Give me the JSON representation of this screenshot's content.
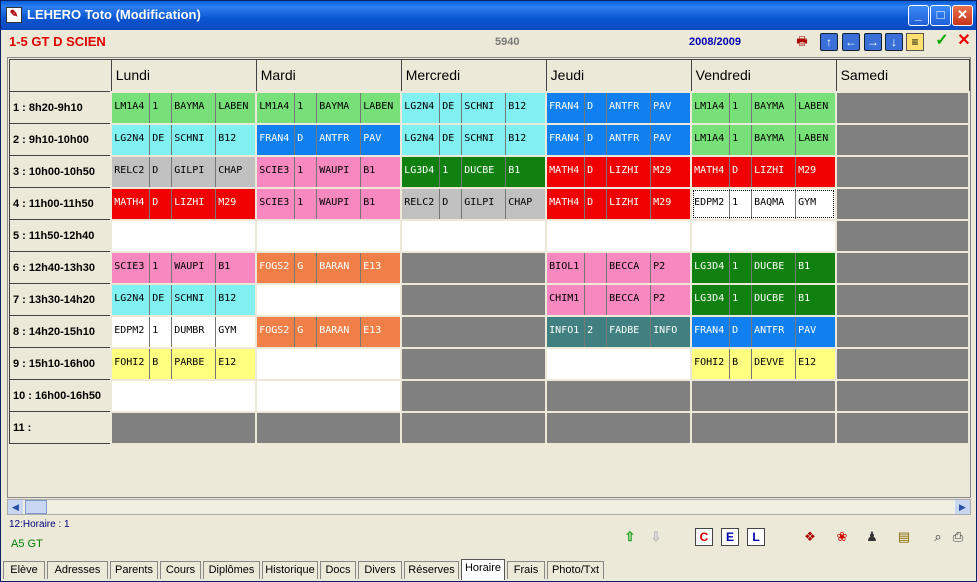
{
  "window": {
    "title": "LEHERO Toto (Modification)"
  },
  "header": {
    "class_name": "1-5 GT D SCIEN",
    "code": "5940",
    "year": "2008/2009"
  },
  "days": [
    "Lundi",
    "Mardi",
    "Mercredi",
    "Jeudi",
    "Vendredi",
    "Samedi"
  ],
  "slots": [
    "1 : 8h20-9h10",
    "2 : 9h10-10h00",
    "3 : 10h00-10h50",
    "4 : 11h00-11h50",
    "5 : 11h50-12h40",
    "6 : 12h40-13h30",
    "7 : 13h30-14h20",
    "8 : 14h20-15h10",
    "9 : 15h10-16h00",
    "10 : 16h00-16h50",
    "11 :"
  ],
  "colors": {
    "green": "#78e078",
    "cyan": "#80f0f0",
    "grey": "#c0c0c0",
    "pink": "#f888c0",
    "red": "#f00000",
    "blue": "#1080f0",
    "darkgreen": "#108010",
    "orange": "#f08048",
    "yellow": "#ffff80",
    "teal": "#408080",
    "white": "#ffffff",
    "empty_grey": "#808080"
  },
  "grid": [
    [
      {
        "color": "green",
        "cells": [
          "LM1A4",
          "1",
          "BAYMA",
          "LABEN"
        ]
      },
      {
        "color": "green",
        "cells": [
          "LM1A4",
          "1",
          "BAYMA",
          "LABEN"
        ]
      },
      {
        "color": "cyan",
        "cells": [
          "LG2N4",
          "DE",
          "SCHNI",
          "B12"
        ]
      },
      {
        "color": "blue",
        "cells": [
          "FRAN4",
          "D",
          "ANTFR",
          "PAV"
        ]
      },
      {
        "color": "green",
        "cells": [
          "LM1A4",
          "1",
          "BAYMA",
          "LABEN"
        ]
      },
      {
        "color": "empty_grey"
      }
    ],
    [
      {
        "color": "cyan",
        "cells": [
          "LG2N4",
          "DE",
          "SCHNI",
          "B12"
        ]
      },
      {
        "color": "blue",
        "cells": [
          "FRAN4",
          "D",
          "ANTFR",
          "PAV"
        ]
      },
      {
        "color": "cyan",
        "cells": [
          "LG2N4",
          "DE",
          "SCHNI",
          "B12"
        ]
      },
      {
        "color": "blue",
        "cells": [
          "FRAN4",
          "D",
          "ANTFR",
          "PAV"
        ]
      },
      {
        "color": "green",
        "cells": [
          "LM1A4",
          "1",
          "BAYMA",
          "LABEN"
        ]
      },
      {
        "color": "empty_grey"
      }
    ],
    [
      {
        "color": "grey",
        "cells": [
          "RELC2",
          "D",
          "GILPI",
          "CHAP"
        ]
      },
      {
        "color": "pink",
        "cells": [
          "SCIE3",
          "1",
          "WAUPI",
          "B1"
        ]
      },
      {
        "color": "darkgreen",
        "cells": [
          "LG3D4",
          "1",
          "DUCBE",
          "B1"
        ]
      },
      {
        "color": "red",
        "cells": [
          "MATH4",
          "D",
          "LIZHI",
          "M29"
        ]
      },
      {
        "color": "red",
        "cells": [
          "MATH4",
          "D",
          "LIZHI",
          "M29"
        ]
      },
      {
        "color": "empty_grey"
      }
    ],
    [
      {
        "color": "red",
        "cells": [
          "MATH4",
          "D",
          "LIZHI",
          "M29"
        ]
      },
      {
        "color": "pink",
        "cells": [
          "SCIE3",
          "1",
          "WAUPI",
          "B1"
        ]
      },
      {
        "color": "grey",
        "cells": [
          "RELC2",
          "D",
          "GILPI",
          "CHAP"
        ]
      },
      {
        "color": "red",
        "cells": [
          "MATH4",
          "D",
          "LIZHI",
          "M29"
        ]
      },
      {
        "color": "white",
        "cells": [
          "EDPM2",
          "1",
          "BAQMA",
          "GYM"
        ]
      },
      {
        "color": "empty_grey"
      }
    ],
    [
      {
        "color": "white"
      },
      {
        "color": "white"
      },
      {
        "color": "white"
      },
      {
        "color": "white"
      },
      {
        "color": "white"
      },
      {
        "color": "empty_grey"
      }
    ],
    [
      {
        "color": "pink",
        "cells": [
          "SCIE3",
          "1",
          "WAUPI",
          "B1"
        ]
      },
      {
        "color": "orange",
        "cells": [
          "FOGS2",
          "G",
          "BARAN",
          "E13"
        ]
      },
      {
        "color": "empty_grey"
      },
      {
        "color": "pink",
        "cells": [
          "BIOL1",
          "",
          "BECCA",
          "P2"
        ]
      },
      {
        "color": "darkgreen",
        "cells": [
          "LG3D4",
          "1",
          "DUCBE",
          "B1"
        ]
      },
      {
        "color": "empty_grey"
      }
    ],
    [
      {
        "color": "cyan",
        "cells": [
          "LG2N4",
          "DE",
          "SCHNI",
          "B12"
        ]
      },
      {
        "color": "white"
      },
      {
        "color": "empty_grey"
      },
      {
        "color": "pink",
        "cells": [
          "CHIM1",
          "",
          "BECCA",
          "P2"
        ]
      },
      {
        "color": "darkgreen",
        "cells": [
          "LG3D4",
          "1",
          "DUCBE",
          "B1"
        ]
      },
      {
        "color": "empty_grey"
      }
    ],
    [
      {
        "color": "white",
        "cells": [
          "EDPM2",
          "1",
          "DUMBR",
          "GYM"
        ]
      },
      {
        "color": "orange",
        "cells": [
          "FOGS2",
          "G",
          "BARAN",
          "E13"
        ]
      },
      {
        "color": "empty_grey"
      },
      {
        "color": "teal",
        "cells": [
          "INFO1",
          "2",
          "FADBE",
          "INFO"
        ]
      },
      {
        "color": "blue",
        "cells": [
          "FRAN4",
          "D",
          "ANTFR",
          "PAV"
        ]
      },
      {
        "color": "empty_grey"
      }
    ],
    [
      {
        "color": "yellow",
        "cells": [
          "FOHI2",
          "B",
          "PARBE",
          "E12"
        ]
      },
      {
        "color": "white"
      },
      {
        "color": "empty_grey"
      },
      {
        "color": "white"
      },
      {
        "color": "yellow",
        "cells": [
          "FOHI2",
          "B",
          "DEVVE",
          "E12"
        ]
      },
      {
        "color": "empty_grey"
      }
    ],
    [
      {
        "color": "white"
      },
      {
        "color": "white"
      },
      {
        "color": "empty_grey"
      },
      {
        "color": "empty_grey"
      },
      {
        "color": "empty_grey"
      },
      {
        "color": "empty_grey"
      }
    ],
    [
      {
        "color": "empty_grey"
      },
      {
        "color": "empty_grey"
      },
      {
        "color": "empty_grey"
      },
      {
        "color": "empty_grey"
      },
      {
        "color": "empty_grey"
      },
      {
        "color": "empty_grey"
      }
    ]
  ],
  "status": {
    "line1": "12:Horaire : 1",
    "line2": "A5 GT"
  },
  "bottom_icons": {
    "c": "C",
    "e": "E",
    "l": "L"
  },
  "tabs": [
    "Elève",
    "Adresses",
    "Parents",
    "Cours",
    "Diplômes",
    "Historique",
    "Docs",
    "Divers",
    "Réserves",
    "Horaire",
    "Frais",
    "Photo/Txt"
  ],
  "active_tab": "Horaire"
}
